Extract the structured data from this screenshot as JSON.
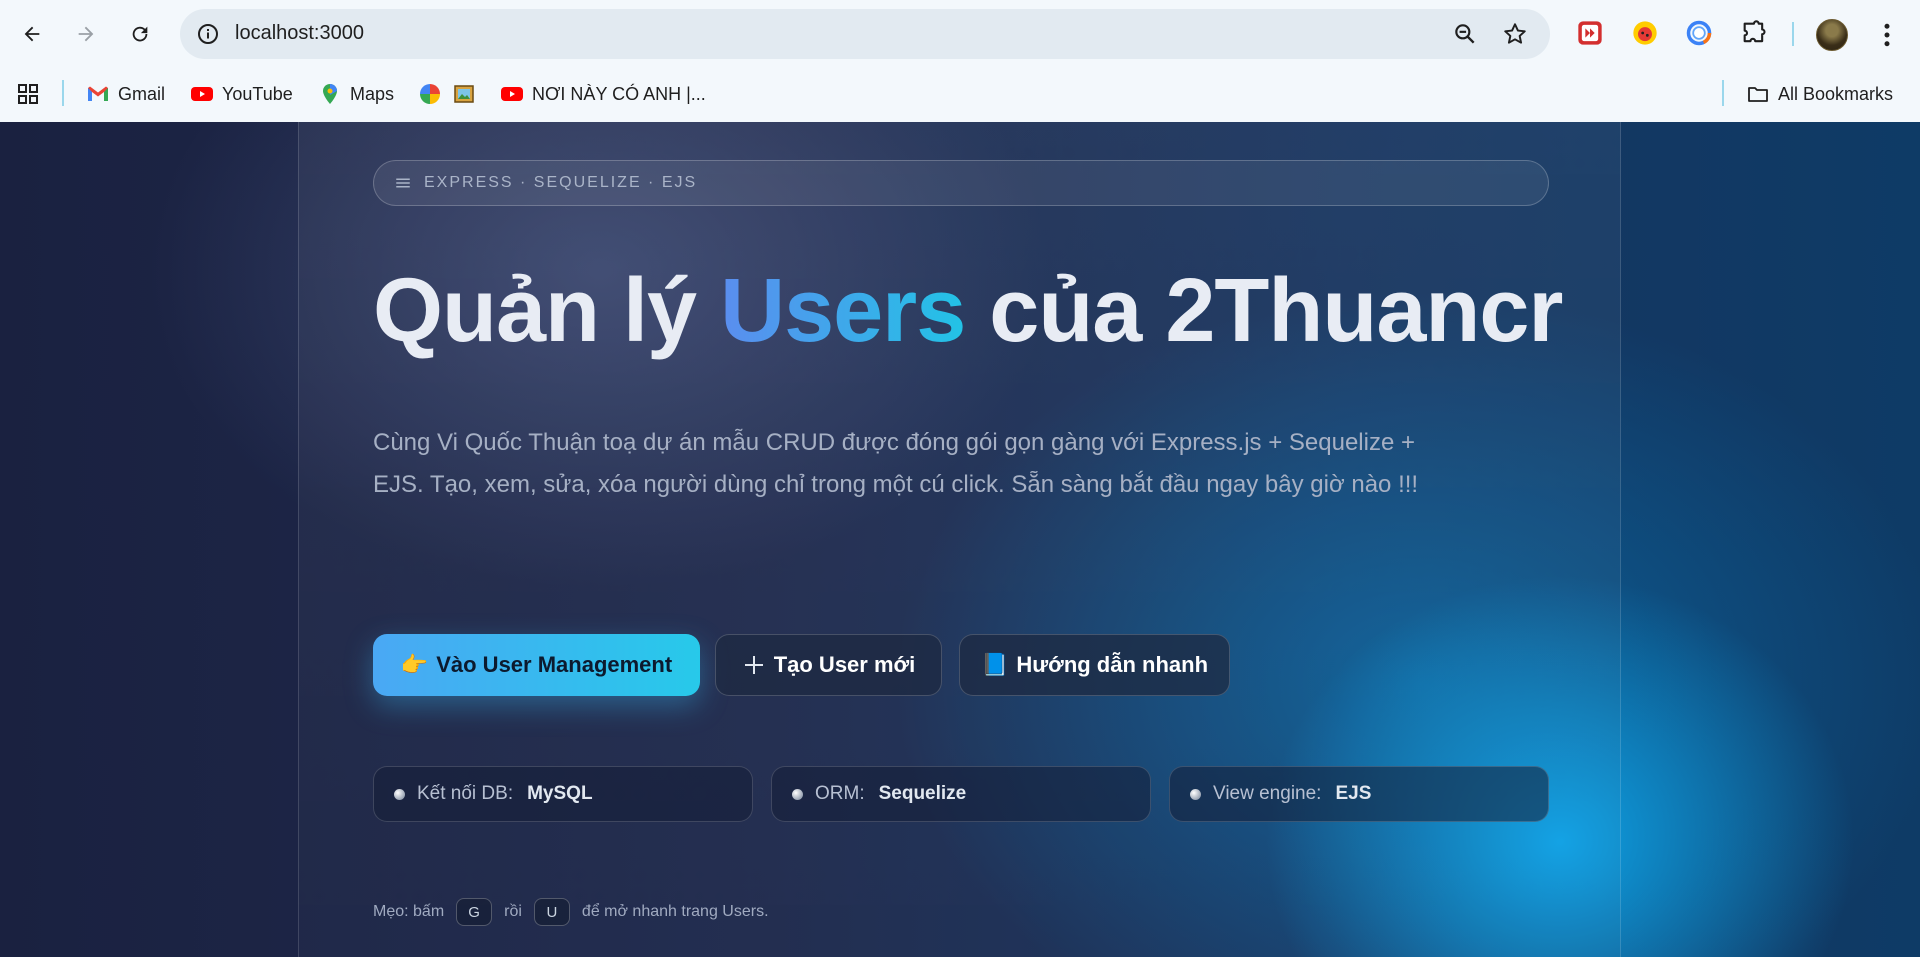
{
  "browser": {
    "url": "localhost:3000",
    "bookmarks": {
      "gmail": "Gmail",
      "youtube": "YouTube",
      "maps": "Maps",
      "video": "NƠI NÀY CÓ ANH |...",
      "all": "All Bookmarks"
    },
    "colors": {
      "chrome_bg": "#f3f8fc",
      "omnibox_bg": "#e2eaf1",
      "separator": "#9ad7ec"
    }
  },
  "page": {
    "tagline": "EXPRESS · SEQUELIZE · EJS",
    "title": {
      "part1": "Quản lý ",
      "accent": "Users",
      "part2": " của 2Thuancr"
    },
    "description": "Cùng Vi Quốc Thuận toạ dự án mẫu CRUD được đóng gói gọn gàng với Express.js + Sequelize + EJS. Tạo, xem, sửa, xóa người dùng chỉ trong một cú click. Sẵn sàng bắt đầu ngay bây giờ nào !!!",
    "buttons": {
      "primary": {
        "icon": "👉",
        "label": "Vào User Management"
      },
      "create": {
        "icon": "➕",
        "label": "Tạo User mới"
      },
      "guide": {
        "icon": "📘",
        "label": "Hướng dẫn nhanh"
      }
    },
    "stats": [
      {
        "label": "Kết nối DB:",
        "value": "MySQL"
      },
      {
        "label": "ORM:",
        "value": "Sequelize"
      },
      {
        "label": "View engine:",
        "value": "EJS"
      }
    ],
    "hint": {
      "prefix": "Mẹo: bấm",
      "key1": "G",
      "middle": "rồi",
      "key2": "U",
      "suffix": "để mở nhanh trang Users."
    },
    "colors": {
      "accent_start": "#5b8def",
      "accent_end": "#22c3e6",
      "primary_btn": "#27c9ea"
    }
  }
}
